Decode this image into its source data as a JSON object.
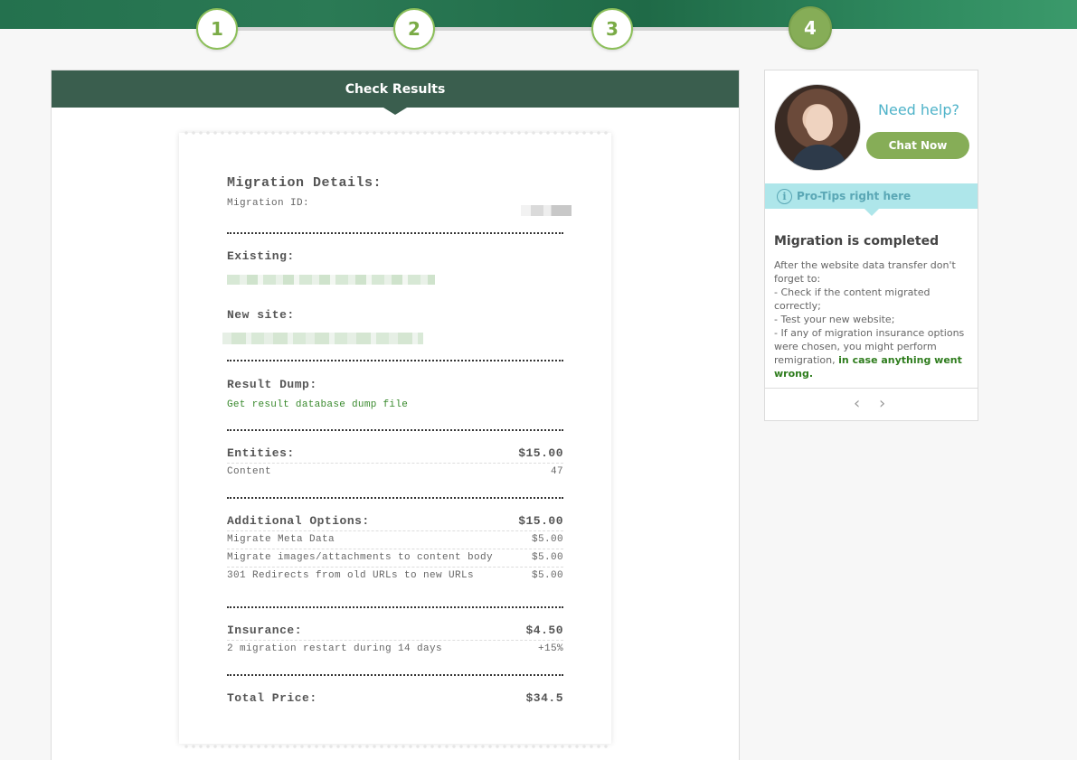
{
  "steps": [
    "1",
    "2",
    "3",
    "4"
  ],
  "panel": {
    "title": "Check Results"
  },
  "receipt": {
    "migration_details_title": "Migration Details:",
    "migration_id_label": "Migration ID:",
    "existing_label": "Existing:",
    "new_site_label": "New site:",
    "result_dump_label": "Result Dump:",
    "result_dump_link": "Get result database dump file",
    "entities": {
      "label": "Entities:",
      "total": "$15.00",
      "items": [
        {
          "name": "Content",
          "value": "47"
        }
      ]
    },
    "additional_options": {
      "label": "Additional Options:",
      "total": "$15.00",
      "items": [
        {
          "name": "Migrate Meta Data",
          "value": "$5.00"
        },
        {
          "name": "Migrate images/attachments to content body",
          "value": "$5.00"
        },
        {
          "name": "301 Redirects from old URLs to new URLs",
          "value": "$5.00"
        }
      ]
    },
    "insurance": {
      "label": "Insurance:",
      "total": "$4.50",
      "items": [
        {
          "name": "2 migration restart during 14 days",
          "value": "+15%"
        }
      ]
    },
    "total_price": {
      "label": "Total Price:",
      "value": "$34.5"
    }
  },
  "help": {
    "need_help": "Need help?",
    "chat_button": "Chat Now",
    "tips_bar": "Pro-Tips right here",
    "info_icon": "i",
    "tip_title": "Migration is completed",
    "tip_lines": [
      "After the website data transfer don't forget to:",
      "- Check if the content migrated correctly;",
      "- Test your new website;",
      "- If any of migration insurance options were chosen, you might perform remigration,"
    ],
    "tip_highlight": "in case anything went wrong.",
    "prev_arrow": "‹",
    "next_arrow": "›"
  },
  "colors": {
    "accent_green": "#86ad57",
    "header_dark": "#3a5e4e",
    "tips_cyan": "#aee6ea",
    "help_blue": "#4fb3c9"
  }
}
